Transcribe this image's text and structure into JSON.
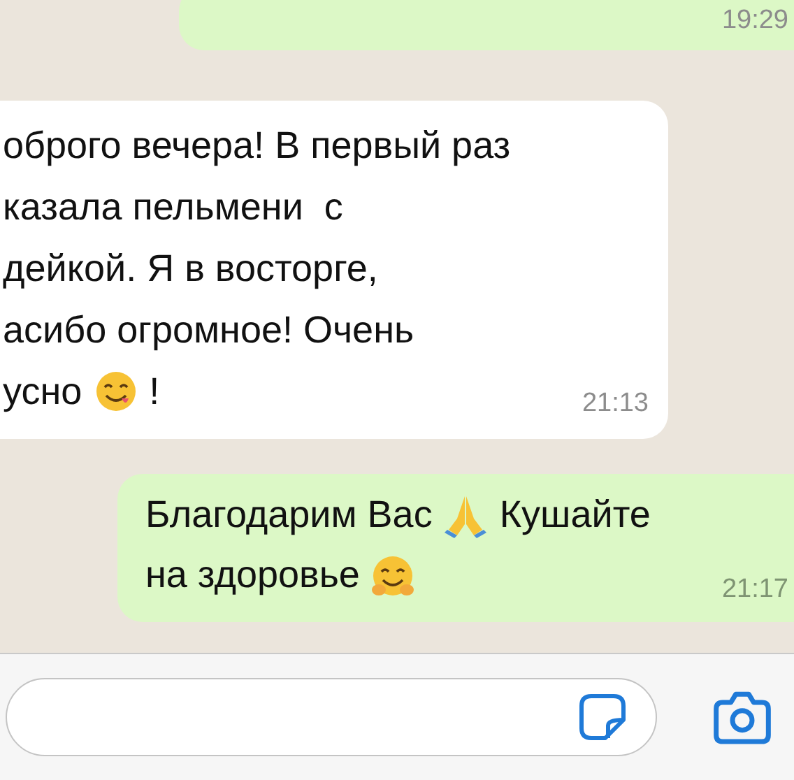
{
  "messages": [
    {
      "kind": "out",
      "time": "19:29"
    },
    {
      "kind": "in",
      "lines": [
        [
          {
            "kind": "text",
            "text": "оброго вечера! В первый раз"
          }
        ],
        [
          {
            "kind": "text",
            "text": "казала пельмени  с"
          }
        ],
        [
          {
            "kind": "text",
            "text": "дейкой. Я в восторге,"
          }
        ],
        [
          {
            "kind": "text",
            "text": "асибо огромное! Очень"
          }
        ],
        [
          {
            "kind": "text",
            "text": "усно"
          },
          {
            "kind": "yum"
          },
          {
            "kind": "text",
            "text": "!"
          }
        ]
      ],
      "time": "21:13"
    },
    {
      "kind": "out",
      "lines": [
        [
          {
            "kind": "text",
            "text": "Благодарим Вас"
          },
          {
            "kind": "pray"
          },
          {
            "kind": "text",
            "text": "Кушайте"
          }
        ],
        [
          {
            "kind": "text",
            "text": "на здоровье"
          },
          {
            "kind": "hug"
          }
        ]
      ],
      "time": "21:17"
    }
  ]
}
